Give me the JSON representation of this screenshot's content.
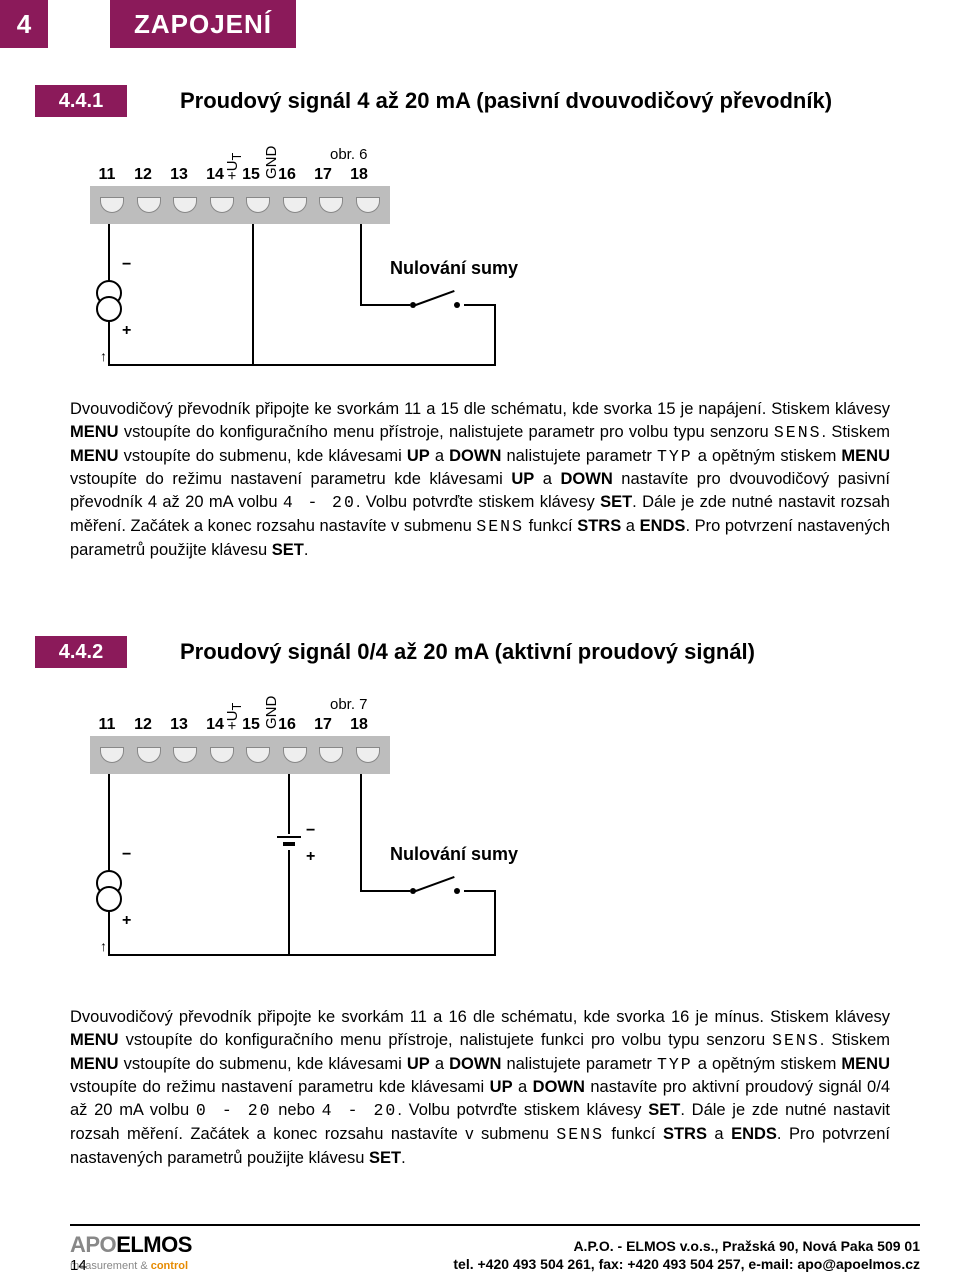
{
  "chapter": {
    "num": "4",
    "title": "ZAPOJENÍ"
  },
  "section1": {
    "num": "4.4.1",
    "title": "Proudový signál 4 až 20 mA (pasivní dvouvodičový převodník)",
    "obr": "obr. 6",
    "null_sumy": "Nulování sumy",
    "pin_numbers": [
      "11",
      "12",
      "13",
      "14",
      "15",
      "16",
      "17",
      "18"
    ],
    "sig_ut": "+U",
    "sig_ut_sub": "T",
    "sig_gnd": "GND",
    "body": "Dvouvodičový převodník připojte ke svorkám 11 a 15 dle schématu, kde svorka 15 je napájení. Stiskem klávesy <b>MENU</b> vstoupíte do konfiguračního menu přístroje, nalistujete parametr pro volbu typu senzoru <span class='mono'>SENS</span>. Stiskem <b>MENU</b> vstoupíte do submenu, kde klávesami <b>UP</b> a <b>DOWN</b> nalistujete parametr <span class='mono'>TYP</span> a opětným stiskem <b>MENU</b> vstoupíte do režimu nastavení parametru kde klávesami <b>UP</b> a <b>DOWN</b> nastavíte pro dvouvodičový pasivní převodník 4 až 20 mA volbu <span class='mono'>4 - 20</span>. Volbu potvrďte stiskem klávesy <b>SET</b>. Dále je zde nutné nastavit rozsah měření. Začátek a konec rozsahu nastavíte v submenu <span class='mono'>SENS</span> funkcí <b>STRS</b> a <b>ENDS</b>. Pro potvrzení nastavených parametrů použijte klávesu <b>SET</b>."
  },
  "section2": {
    "num": "4.4.2",
    "title": "Proudový signál 0/4 až 20 mA (aktivní proudový signál)",
    "obr": "obr. 7",
    "null_sumy": "Nulování sumy",
    "pin_numbers": [
      "11",
      "12",
      "13",
      "14",
      "15",
      "16",
      "17",
      "18"
    ],
    "sig_ut": "+U",
    "sig_ut_sub": "T",
    "sig_gnd": "GND",
    "body": "Dvouvodičový převodník připojte ke svorkám 11 a 16 dle schématu, kde svorka 16 je mínus. Stiskem klávesy <b>MENU</b> vstoupíte do konfiguračního menu přístroje, nalistujete funkci pro volbu typu senzoru <span class='mono'>SENS</span>. Stiskem <b>MENU</b> vstoupíte do submenu, kde klávesami <b>UP</b> a <b>DOWN</b> nalistujete parametr <span class='mono'>TYP</span> a opětným stiskem <b>MENU</b> vstoupíte do režimu nastavení parametru kde klávesami <b>UP</b> a <b>DOWN</b> nastavíte pro aktivní proudový signál 0/4 až 20 mA volbu <span class='mono'>0 - 20</span> nebo <span class='mono'>4 - 20</span>. Volbu potvrďte stiskem klávesy <b>SET</b>. Dále je zde nutné nastavit rozsah měření. Začátek a konec rozsahu nastavíte v submenu <span class='mono'>SENS</span> funkcí <b>STRS</b> a <b>ENDS</b>. Pro potvrzení nastavených parametrů použijte klávesu <b>SET</b>."
  },
  "footer": {
    "logo_a": "APO",
    "logo_b": "ELMOS",
    "logo_sub_a": "measurement",
    "logo_sub_amp": " & ",
    "logo_sub_b": "control",
    "addr": "A.P.O. - ELMOS v.o.s., Pražská 90, Nová Paka 509 01",
    "contact": "tel. +420 493 504 261, fax: +420 493 504 257, e-mail: apo@apoelmos.cz",
    "page": "14"
  }
}
